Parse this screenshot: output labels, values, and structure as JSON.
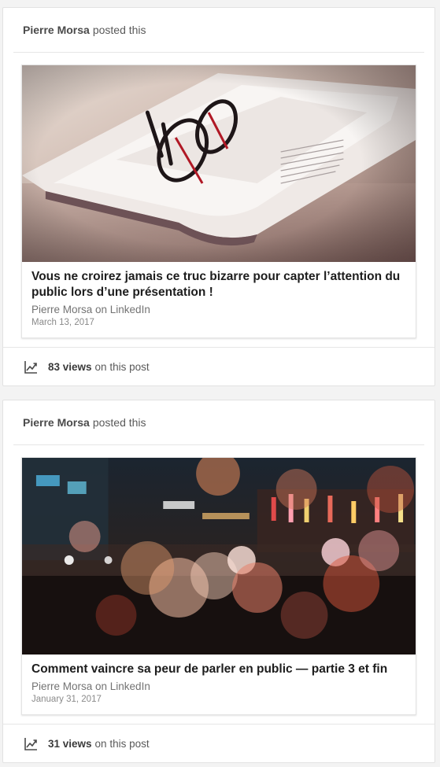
{
  "posts": [
    {
      "header": {
        "author": "Pierre Morsa",
        "action": "posted this"
      },
      "article": {
        "image_icon": "newspaper-with-glasses-image",
        "title": "Vous ne croirez jamais ce truc bizarre pour capter l’attention du public lors d’une présentation !",
        "source": "Pierre Morsa on LinkedIn",
        "date": "March 13, 2017"
      },
      "footer": {
        "icon": "chart-trend-icon",
        "views": "83 views",
        "suffix": "on this post"
      }
    },
    {
      "header": {
        "author": "Pierre Morsa",
        "action": "posted this"
      },
      "article": {
        "image_icon": "city-night-bokeh-image",
        "title": "Comment vaincre sa peur de parler en public — partie 3 et fin",
        "source": "Pierre Morsa on LinkedIn",
        "date": "January 31, 2017"
      },
      "footer": {
        "icon": "chart-trend-icon",
        "views": "31 views",
        "suffix": "on this post"
      }
    }
  ]
}
